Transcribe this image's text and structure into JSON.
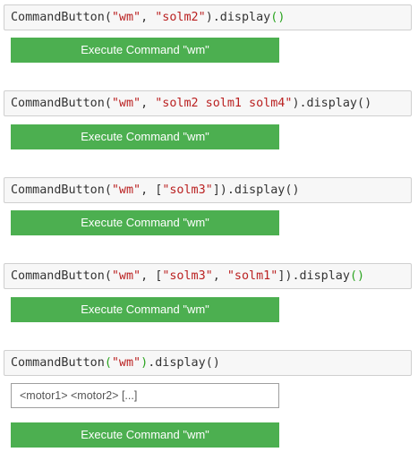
{
  "accent_color": "#4caf50",
  "bracket_highlight_color": "#2aa41f",
  "string_color": "#ba2121",
  "cells": [
    {
      "code": {
        "fn": "CommandButton",
        "open": "(",
        "s1": "\"wm\"",
        "sep1": ", ",
        "s2": "\"solm2\"",
        "close": ")",
        "method": ".display",
        "mopen": "(",
        "mclose": ")"
      },
      "button_label": "Execute Command \"wm\""
    },
    {
      "code": {
        "fn": "CommandButton",
        "open": "(",
        "s1": "\"wm\"",
        "sep1": ", ",
        "s2": "\"solm2 solm1 solm4\"",
        "close": ")",
        "method": ".display",
        "mopen": "(",
        "mclose": ")"
      },
      "button_label": "Execute Command \"wm\""
    },
    {
      "code": {
        "fn": "CommandButton",
        "open": "(",
        "s1": "\"wm\"",
        "sep1": ", [",
        "s2": "\"solm3\"",
        "close": "])",
        "method": ".display",
        "mopen": "(",
        "mclose": ")"
      },
      "button_label": "Execute Command \"wm\""
    },
    {
      "code": {
        "fn": "CommandButton",
        "open": "(",
        "s1": "\"wm\"",
        "sep1": ", [",
        "s2": "\"solm3\"",
        "sep2": ", ",
        "s3": "\"solm1\"",
        "close": "])",
        "method": ".display",
        "mopen": "(",
        "mclose": ")"
      },
      "button_label": "Execute Command \"wm\""
    },
    {
      "code": {
        "fn": "CommandButton",
        "open": "(",
        "s1": "\"wm\"",
        "close": ")",
        "method": ".display",
        "mopen": "(",
        "mclose": ")"
      },
      "input_placeholder": "<motor1> <motor2> [...]",
      "button_label": "Execute Command \"wm\""
    }
  ]
}
